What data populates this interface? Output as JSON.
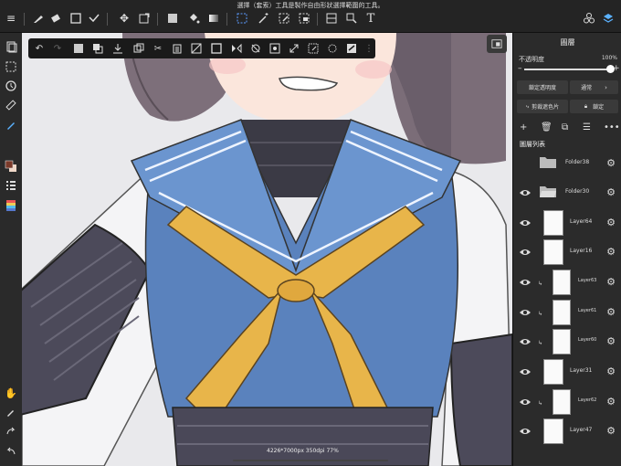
{
  "status": {
    "text": "選擇（套索）工具是製作自由形狀選擇範圍的工具。"
  },
  "canvas_info": {
    "text": "4226*7000px 350dpi 77%"
  },
  "layers_panel": {
    "title": "圖層",
    "opacity_label": "不透明度",
    "opacity_value": "100%",
    "opacity_level": 1.0,
    "lock_alpha_label": "鎖定透明度",
    "blend_mode": "通常",
    "clipping_label": "剪裁遮色片",
    "lock_label": "鎖定",
    "list_title": "圖層列表",
    "layers": [
      {
        "name": "Folder38",
        "type": "folder",
        "visible": false
      },
      {
        "name": "Folder30",
        "type": "folder",
        "visible": true
      },
      {
        "name": "Layer64",
        "type": "layer",
        "visible": true
      },
      {
        "name": "Layer16",
        "type": "layer",
        "visible": true
      },
      {
        "name": "Layer63",
        "type": "clip",
        "visible": true
      },
      {
        "name": "Layer61",
        "type": "clip",
        "visible": true
      },
      {
        "name": "Layer60",
        "type": "clip",
        "visible": true
      },
      {
        "name": "Layer31",
        "type": "layer",
        "visible": true
      },
      {
        "name": "Layer62",
        "type": "clip",
        "visible": true
      },
      {
        "name": "Layer47",
        "type": "layer",
        "visible": true
      }
    ]
  },
  "colors": {
    "primary": "#7a3a2a",
    "secondary": "#f0d8c8"
  },
  "text_tool_glyph": "T"
}
